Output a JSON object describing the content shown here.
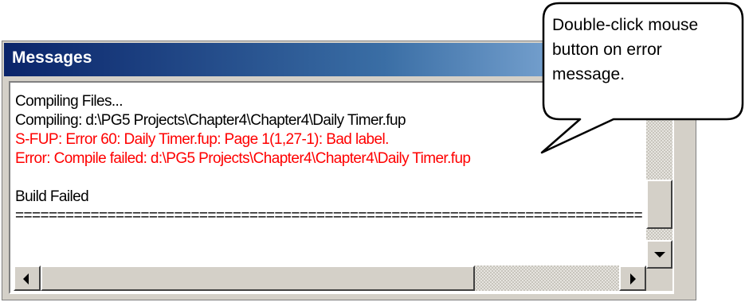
{
  "window": {
    "title": "Messages"
  },
  "messages": [
    {
      "text": "Compiling Files...",
      "color": "#000000"
    },
    {
      "text": "Compiling: d:\\PG5 Projects\\Chapter4\\Chapter4\\Daily Timer.fup",
      "color": "#000000"
    },
    {
      "text": "S-FUP: Error 60: Daily Timer.fup: Page 1(1,27-1):  Bad label.",
      "color": "#ff0000"
    },
    {
      "text": "Error: Compile failed: d:\\PG5 Projects\\Chapter4\\Chapter4\\Daily Timer.fup",
      "color": "#ff0000"
    },
    {
      "text": "",
      "color": "#000000"
    },
    {
      "text": "Build Failed",
      "color": "#000000"
    },
    {
      "text": "===========================================================================",
      "color": "#000000"
    }
  ],
  "callout": {
    "lines": [
      "Double-click mouse",
      "button on error",
      "message."
    ]
  },
  "icons": {
    "scroll_down": "arrow-down-icon",
    "scroll_left": "arrow-left-icon",
    "scroll_right": "arrow-right-icon"
  }
}
